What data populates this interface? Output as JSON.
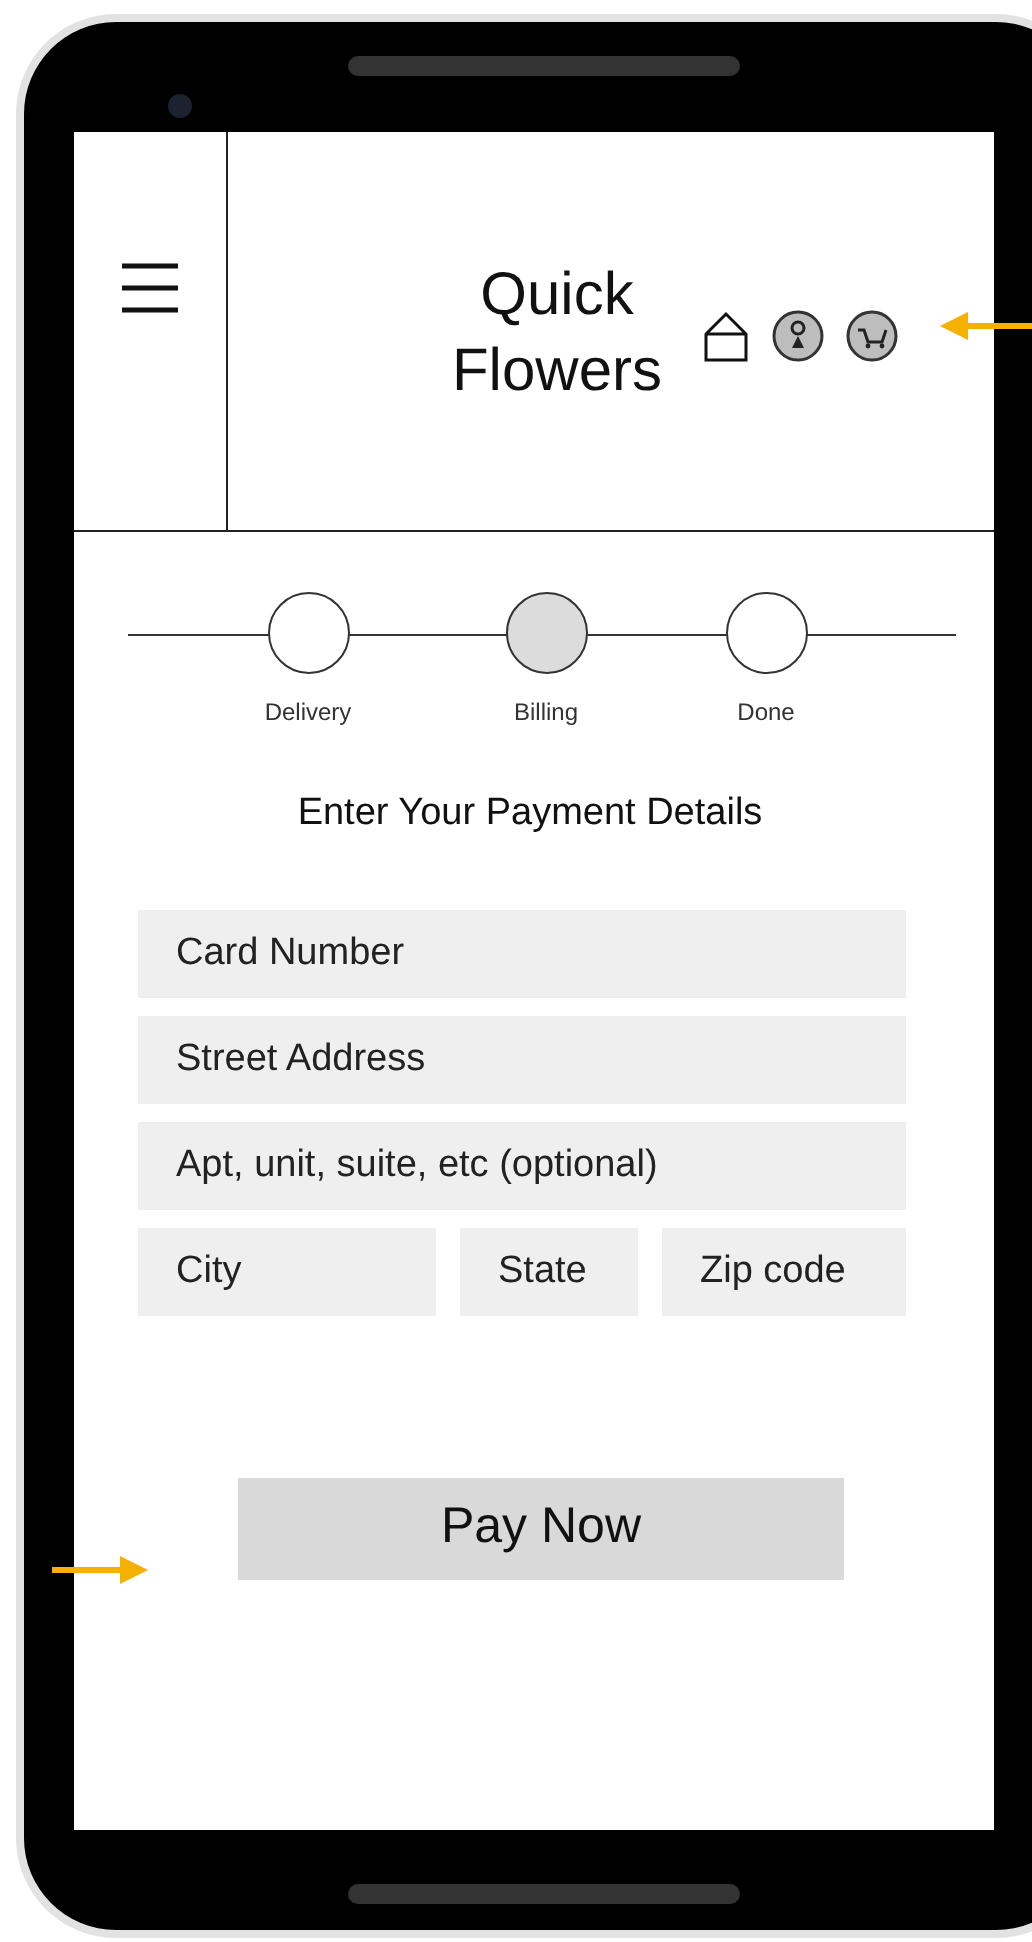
{
  "header": {
    "title": "Quick Flowers"
  },
  "steps": [
    {
      "label": "Delivery",
      "selected": false
    },
    {
      "label": "Billing",
      "selected": true
    },
    {
      "label": "Done",
      "selected": false
    }
  ],
  "heading": "Enter Your Payment Details",
  "field_rows": [
    [
      {
        "placeholder": "Card Number"
      }
    ],
    [
      {
        "placeholder": "Street Address"
      }
    ],
    [
      {
        "placeholder": "Apt, unit, suite, etc (optional)"
      }
    ],
    [
      {
        "placeholder": "City"
      },
      {
        "placeholder": "State"
      },
      {
        "placeholder": "Zip code"
      }
    ]
  ],
  "pay_button": "Pay Now"
}
